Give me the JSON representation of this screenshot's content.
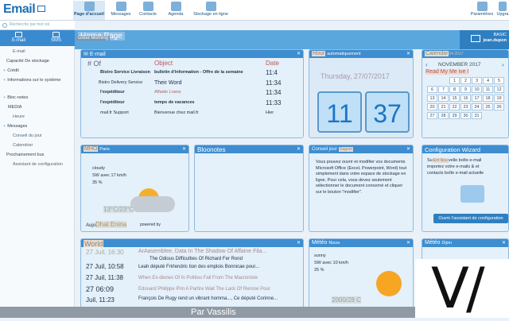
{
  "app": {
    "logo": "Email"
  },
  "nav": [
    {
      "label": "Page d'accueil",
      "icon": "home-icon",
      "active": true
    },
    {
      "label": "Messages",
      "icon": "envelope-icon"
    },
    {
      "label": "Contacts",
      "icon": "contacts-icon"
    },
    {
      "label": "Agenda",
      "icon": "calendar-icon"
    },
    {
      "label": "Stockage en ligne",
      "icon": "cloud-icon"
    }
  ],
  "nav_right": [
    {
      "label": "Paramètres",
      "icon": "gear-icon"
    },
    {
      "label": "Upgra",
      "icon": "upgrade-icon"
    }
  ],
  "search": {
    "placeholder": "Recherche par mot clé"
  },
  "left_tabs": [
    {
      "label": "E-mail"
    },
    {
      "label": "SMS"
    }
  ],
  "left_nav": [
    {
      "label": "E-mail",
      "type": "sub"
    },
    {
      "label": "Capacité De stockage",
      "type": "sub"
    },
    {
      "label": "Crédit",
      "type": "group"
    },
    {
      "label": "Informations sur le système",
      "type": "group"
    },
    {
      "label": "Bloc-notes",
      "type": "group"
    },
    {
      "label": "MEDIA",
      "type": "sub"
    },
    {
      "label": "Heure",
      "type": "sub"
    },
    {
      "label": "Messages",
      "type": "group"
    },
    {
      "label": "Conseil du jour",
      "type": "sub"
    },
    {
      "label": "Calendrier",
      "type": "sub"
    },
    {
      "label": "Prochainement bus",
      "type": "sub"
    },
    {
      "label": "Assistant de configuration",
      "type": "sub"
    }
  ],
  "home": {
    "title": "Home Page",
    "subtitle": "Good Morning",
    "account_type": "BASIC",
    "account_user": "jean.dupon"
  },
  "email_widget": {
    "title": "E-mail",
    "headers": [
      "# Of",
      "Object",
      "Date"
    ],
    "rows": [
      {
        "from": "Bistro Service Livraison",
        "subject": "bulletin d'information - Offre de la semaine",
        "date": "11:4",
        "bold": true
      },
      {
        "from": "Bistro Delivery Service",
        "subject": "Their Word",
        "date": "11:34",
        "bold": false
      },
      {
        "from": "l'expéditeur",
        "subject": "Affaide Loans",
        "date": "11:34",
        "bold": true
      },
      {
        "from": "l'expéditeur",
        "subject": "temps de vacances",
        "date": "11:33",
        "bold": true
      },
      {
        "from": "mail.fr Support",
        "subject": "Bienvenue chez mail.fr",
        "date": "Hier",
        "bold": false
      }
    ]
  },
  "hour_widget": {
    "title": "Hour",
    "subtitle": "automatiquement",
    "date": "Thursday, 27/07/2017",
    "hours": "11",
    "minutes": "37"
  },
  "calendar_widget": {
    "title": "Calendar",
    "extra": "04 2017",
    "month": "NOVEMBER 2017",
    "note": "Read My Me ive I",
    "days": [
      "1",
      "2",
      "3",
      "4",
      "5",
      "6",
      "7",
      "8",
      "9",
      "10",
      "11",
      "12",
      "13",
      "14",
      "15",
      "16",
      "17",
      "18",
      "19",
      "20",
      "21",
      "22",
      "23",
      "24",
      "25",
      "26",
      "27",
      "28",
      "29",
      "30",
      "31"
    ]
  },
  "weather_small": {
    "title": "MHO",
    "location": "Paris",
    "condition": "cloudy",
    "wind": "SW avec 17 km/h",
    "humidity": "35 %",
    "temp": "13°C/23°C",
    "today_label": "Aujo",
    "today_value": "Dhal Enina",
    "powered": "powered by"
  },
  "notes_widget": {
    "title": "Bloonotes"
  },
  "tip_widget": {
    "title": "Conseil jour",
    "tag": "Gagner",
    "text": "Vous pouvez ouvrir et modifier vos documents Microsoft Office (Excel, Powerpoint, Word) tout simplement dans votre espace de stockage en ligne. Pour cela, vous devez seulement sélectionner le document concerné et cliquer sur le bouton \"modifier\"."
  },
  "config_widget": {
    "title": "Configuration Wizard",
    "line1": "Su",
    "line1_tag": "Ent Nou",
    "line1_rest": "velle boîte e-mail",
    "line2": "importez votre e-mails & et",
    "line3": "contact",
    "line3_rest": "s boîte e-mail actuelle",
    "button": "Ouvrir l'assistant de configuration"
  },
  "world_widget": {
    "title": "World",
    "headline": "ArAasemblee, Data In The Shadow Of Affaine Fila...",
    "items": [
      {
        "time": "27 Juil, 16:30",
        "text": "The Odious Difficulties Of Richard Fer Rond"
      },
      {
        "time": "27 Juil, 10:58",
        "text": "Leah député Frirtendric tion des emplois Bonnicae pour..."
      },
      {
        "time": "27 Juil, 11:38",
        "text": "When Ex-diones Of In Politiou Fall From The Macroniste"
      },
      {
        "time": "27 06:09",
        "text": "Edouard Philippe Prin A Partire Wait The Lack Of Rerone Pour"
      },
      {
        "time": "Juil, 11:23",
        "text": "François De Rugy rend un vibrant homma..., Ce député Corinne..."
      }
    ]
  },
  "weather_mid": {
    "title": "Météo",
    "location": "Nizza",
    "condition": "sunny",
    "wind": "SW avec 10 km/h",
    "humidity": "25 %",
    "temp": "2000/28 C"
  },
  "weather_right": {
    "title": "Météo",
    "location": "Dijon"
  },
  "footer": {
    "text": "Par Vassilis"
  }
}
